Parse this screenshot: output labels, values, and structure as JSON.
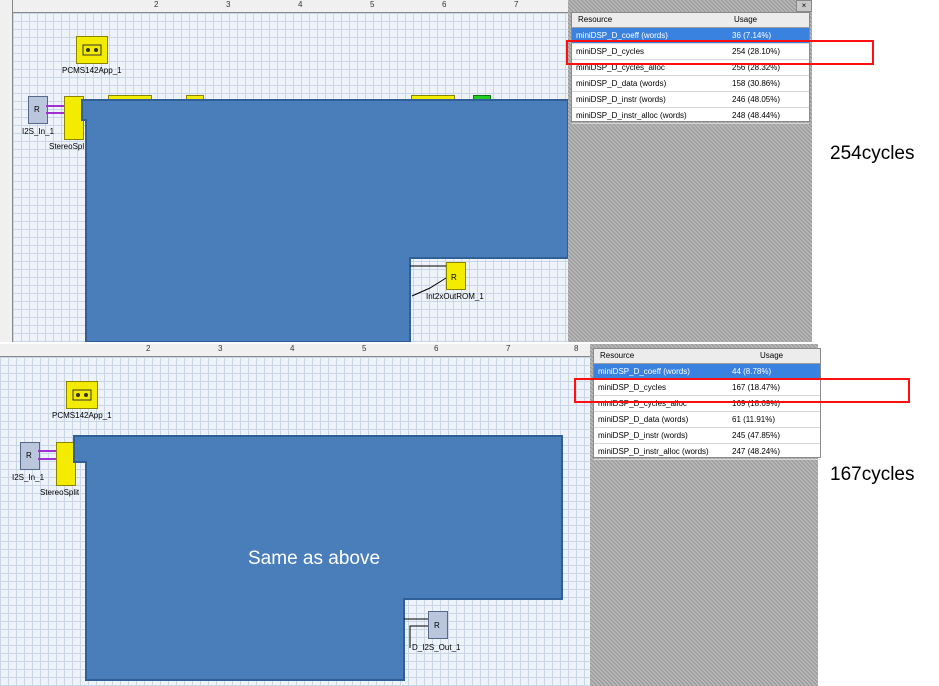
{
  "top_section": {
    "ruler_numbers": [
      "2",
      "3",
      "4",
      "5",
      "6",
      "7"
    ],
    "blocks": {
      "pcm_app_label": "PCMS142App_1",
      "i2s_in_label": "I2S_In_1",
      "stereo_split_label": "StereoSpl",
      "int_out_rom_label": "Int2xOutROM_1"
    },
    "resource_panel": {
      "col_resource": "Resource",
      "col_usage": "Usage",
      "rows": [
        {
          "resource": "miniDSP_D_coeff (words)",
          "usage": "36  (7.14%)"
        },
        {
          "resource": "miniDSP_D_cycles",
          "usage": "254  (28.10%)"
        },
        {
          "resource": "miniDSP_D_cycles_alloc",
          "usage": "256  (28.32%)"
        },
        {
          "resource": "miniDSP_D_data (words)",
          "usage": "158  (30.86%)"
        },
        {
          "resource": "miniDSP_D_instr (words)",
          "usage": "246  (48.05%)"
        },
        {
          "resource": "miniDSP_D_instr_alloc (words)",
          "usage": "248  (48.44%)"
        }
      ]
    },
    "note": "254cycles"
  },
  "bottom_section": {
    "ruler_numbers": [
      "2",
      "3",
      "4",
      "5",
      "6",
      "7",
      "8"
    ],
    "blocks": {
      "pcm_app_label": "PCMS142App_1",
      "i2s_in_label": "I2S_In_1",
      "stereo_split_label": "StereoSplit",
      "i2s_out_label": "D_I2S_Out_1"
    },
    "overlay_text": "Same as above",
    "resource_panel": {
      "col_resource": "Resource",
      "col_usage": "Usage",
      "rows": [
        {
          "resource": "miniDSP_D_coeff (words)",
          "usage": "44  (8.78%)"
        },
        {
          "resource": "miniDSP_D_cycles",
          "usage": "167  (18.47%)"
        },
        {
          "resource": "miniDSP_D_cycles_alloc",
          "usage": "169  (18.69%)"
        },
        {
          "resource": "miniDSP_D_data (words)",
          "usage": "61  (11.91%)"
        },
        {
          "resource": "miniDSP_D_instr (words)",
          "usage": "245  (47.85%)"
        },
        {
          "resource": "miniDSP_D_instr_alloc (words)",
          "usage": "247  (48.24%)"
        }
      ]
    },
    "note": "167cycles"
  },
  "colors": {
    "overlay_blue": "#4a7ebb",
    "overlay_border": "#2f5f96",
    "highlight_red": "#ff1010",
    "selected_row": "#3a82e0"
  }
}
